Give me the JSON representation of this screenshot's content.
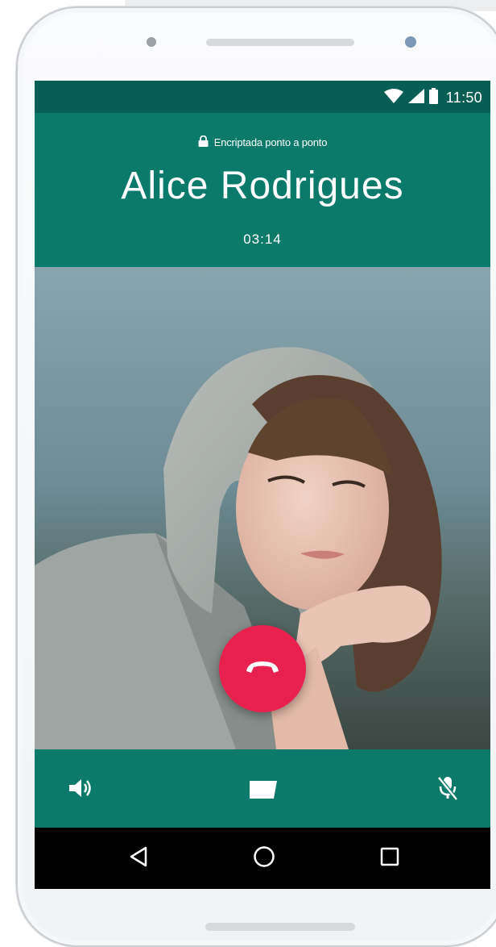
{
  "status_bar": {
    "time": "11:50",
    "icons": [
      "wifi-icon",
      "signal-icon",
      "battery-icon"
    ]
  },
  "call": {
    "encryption_text": "Encriptada ponto a ponto",
    "contact_name": "Alice Rodrigues",
    "duration": "03:14"
  },
  "controls": {
    "items": [
      "speaker-icon",
      "message-icon",
      "mute-mic-icon"
    ],
    "end_call_icon": "end-call-icon"
  },
  "nav": {
    "items": [
      "back-icon",
      "home-icon",
      "recents-icon"
    ]
  },
  "colors": {
    "status_bar": "#075e54",
    "header": "#0b7a6b",
    "end_call": "#e8214f",
    "nav_bar": "#000000"
  }
}
